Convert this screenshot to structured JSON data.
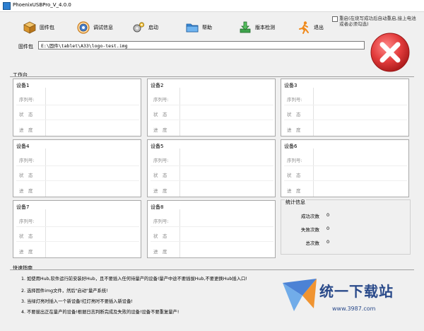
{
  "window": {
    "title": "PhoenixUSBPro_V_4.0.0"
  },
  "toolbar": {
    "firmware": "固件包",
    "debug": "调试信息",
    "start": "启动",
    "help": "帮助",
    "version": "版本检测",
    "exit": "退出"
  },
  "reboot": {
    "text": "重启(在烧写成功后自动重启,接上电池或者必须勾选)",
    "checked": false
  },
  "firmware": {
    "label": "固件包",
    "path": "E:\\固件\\tablet\\A33\\logo-test.img"
  },
  "workspace": {
    "label": "工作台"
  },
  "field_labels": {
    "serial": "序列号:",
    "status": "状　态",
    "progress": "进　度"
  },
  "devices": [
    {
      "name": "设备1"
    },
    {
      "name": "设备2"
    },
    {
      "name": "设备3"
    },
    {
      "name": "设备4"
    },
    {
      "name": "设备5"
    },
    {
      "name": "设备6"
    },
    {
      "name": "设备7"
    },
    {
      "name": "设备8"
    }
  ],
  "stats": {
    "title": "统计信息",
    "success_label": "成功次数",
    "success": "0",
    "fail_label": "失败次数",
    "fail": "0",
    "total_label": "总次数",
    "total": "0"
  },
  "guide": {
    "title": "快速指南",
    "items": [
      "1. 如使用Hub,软件运行前安装好Hub，且不要插入任何待量产的设备!量产中途不要插拔Hub,不要更换Hub插入口!",
      "2. 选择固件img文件，然后\"启动\"量产系统!",
      "3. 当绿灯亮时插入一个新设备!红灯亮时不要插入新设备!",
      "4. 不要拔出正在量产的设备!根据日志判断完成及失败的设备!设备不要重复量产!"
    ]
  },
  "watermark": {
    "text": "统一下载站",
    "url": "www.3987.com"
  },
  "colors": {
    "stop_red": "#e23b3b",
    "accent_blue": "#2a4a8a"
  }
}
